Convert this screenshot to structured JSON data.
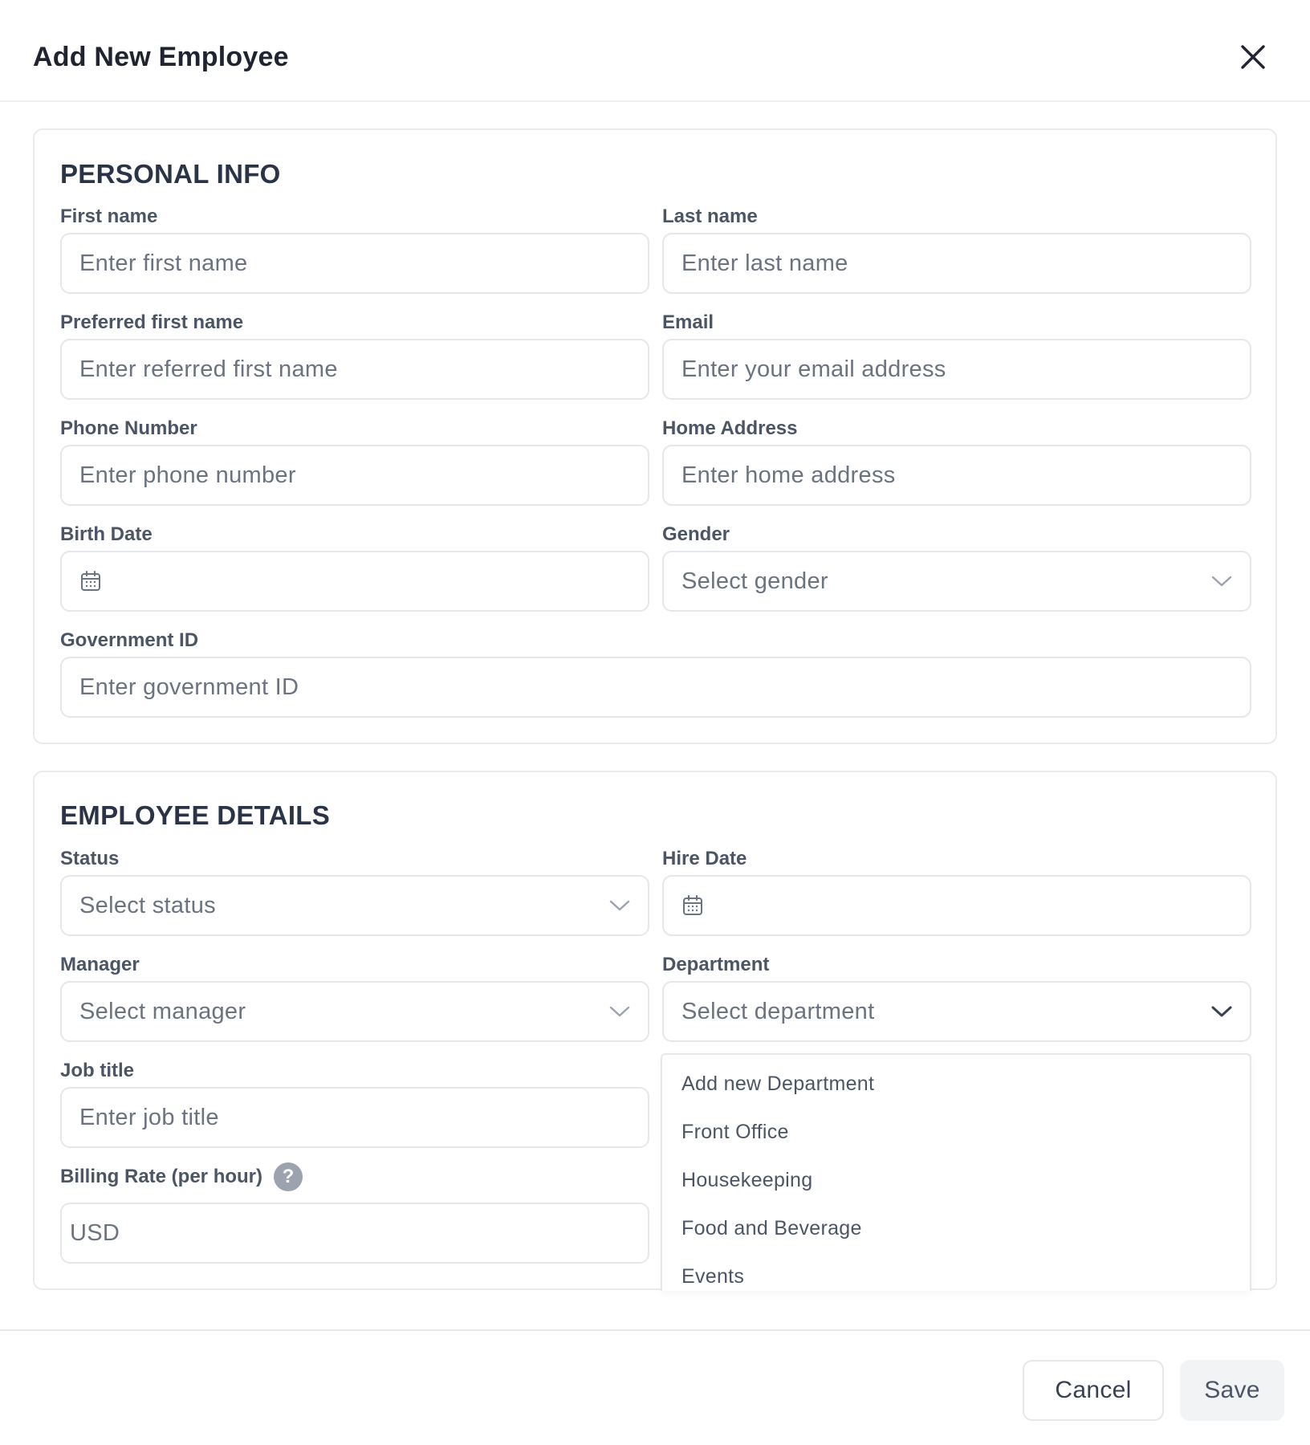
{
  "modal": {
    "title": "Add New Employee",
    "close_icon": "close-icon"
  },
  "personal_info": {
    "title": "PERSONAL INFO",
    "first_name": {
      "label": "First name",
      "placeholder": "Enter first name"
    },
    "last_name": {
      "label": "Last name",
      "placeholder": "Enter last name"
    },
    "preferred_first_name": {
      "label": "Preferred first name",
      "placeholder": "Enter referred first name"
    },
    "email": {
      "label": "Email",
      "placeholder": "Enter your email address"
    },
    "phone_number": {
      "label": "Phone Number",
      "placeholder": "Enter phone number"
    },
    "home_address": {
      "label": "Home Address",
      "placeholder": "Enter home address"
    },
    "birth_date": {
      "label": "Birth Date",
      "icon": "calendar-icon"
    },
    "gender": {
      "label": "Gender",
      "placeholder": "Select gender"
    },
    "government_id": {
      "label": "Government ID",
      "placeholder": "Enter government ID"
    }
  },
  "employee_details": {
    "title": "EMPLOYEE DETAILS",
    "status": {
      "label": "Status",
      "placeholder": "Select status"
    },
    "hire_date": {
      "label": "Hire Date",
      "icon": "calendar-icon"
    },
    "manager": {
      "label": "Manager",
      "placeholder": "Select manager"
    },
    "department": {
      "label": "Department",
      "placeholder": "Select department"
    },
    "job_title": {
      "label": "Job title",
      "placeholder": "Enter job title"
    },
    "billing_rate": {
      "label": "Billing Rate (per hour)",
      "help": "?",
      "value": "USD"
    }
  },
  "department_dropdown": {
    "options": [
      "Add new Department",
      "Front Office",
      "Housekeeping",
      "Food and Beverage",
      "Events"
    ]
  },
  "footer": {
    "cancel_label": "Cancel",
    "save_label": "Save"
  },
  "colors": {
    "border": "#e5e7eb",
    "placeholder": "#6b7280",
    "label": "#4b5565",
    "help_icon_bg": "#9ca3af",
    "save_bg": "#f1f3f5"
  }
}
